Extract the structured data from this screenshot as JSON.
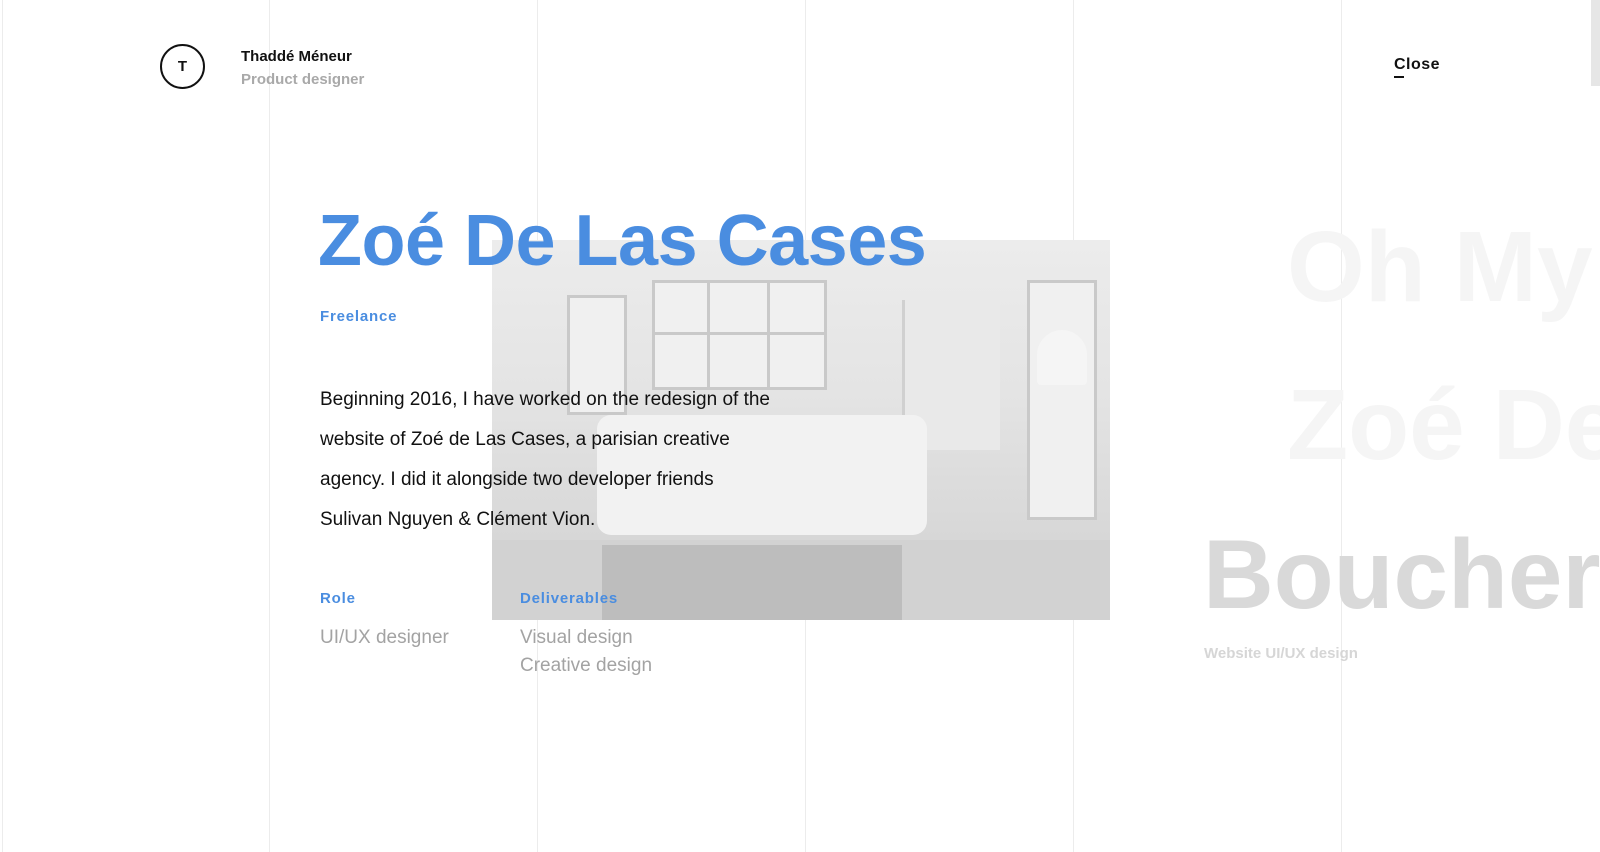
{
  "header": {
    "logo_letter": "T",
    "author_name": "Thaddé Méneur",
    "author_role": "Product designer",
    "close_label": "Close"
  },
  "project": {
    "title": "Zoé De Las Cases",
    "type": "Freelance",
    "description": "Beginning 2016, I have worked on the redesign of the website of Zoé de Las Cases, a parisian creative agency. I did it alongside two developer friends Sulivan Nguyen & Clément Vion.",
    "role_label": "Role",
    "role_value": "UI/UX designer",
    "deliverables_label": "Deliverables",
    "deliverables": [
      "Visual design",
      "Creative design"
    ]
  },
  "project_list": {
    "items": [
      "Oh My",
      "Zoé De",
      "Boucher"
    ],
    "active_subtitle": "Website UI/UX design"
  },
  "colors": {
    "accent": "#4a8de0",
    "text": "#111111",
    "muted": "#a3a3a3"
  }
}
